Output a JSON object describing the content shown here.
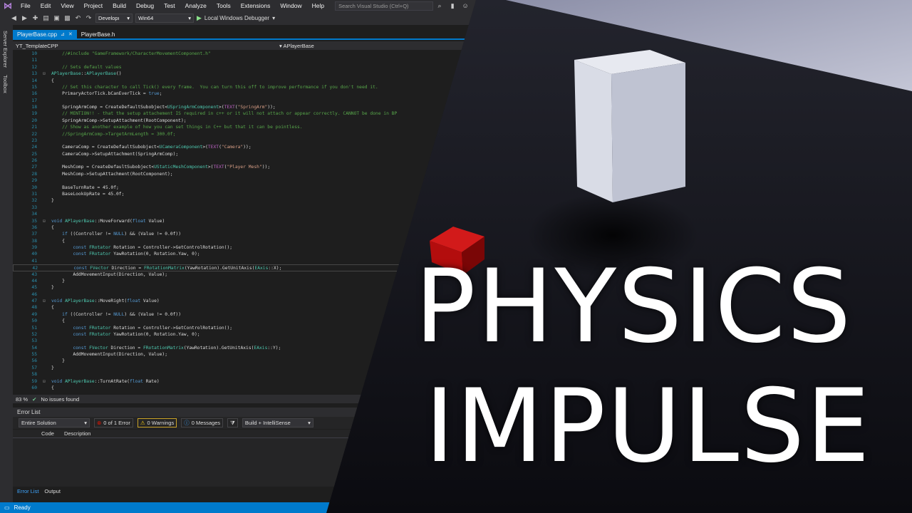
{
  "menu": {
    "items": [
      "File",
      "Edit",
      "View",
      "Project",
      "Build",
      "Debug",
      "Test",
      "Analyze",
      "Tools",
      "Extensions",
      "Window",
      "Help"
    ],
    "search_placeholder": "Search Visual Studio (Ctrl+Q)"
  },
  "toolbar": {
    "config": "Developı",
    "platform": "Win64",
    "debugger": "Local Windows Debugger"
  },
  "side_tabs": {
    "server_explorer": "Server Explorer",
    "toolbox": "Toolbox"
  },
  "tabs": [
    {
      "label": "PlayerBase.cpp",
      "active": true
    },
    {
      "label": "PlayerBase.h",
      "active": false
    }
  ],
  "navbar": {
    "project": "YT_TemplateCPP",
    "scope": "APlayerBase"
  },
  "code": [
    {
      "n": "10",
      "t": "    //#include \"GameFramework/CharacterMovementComponent.h\"",
      "k": "cm"
    },
    {
      "n": "11",
      "t": "",
      "k": ""
    },
    {
      "n": "12",
      "t": "    // Sets default values",
      "k": "cm"
    },
    {
      "n": "13",
      "t": "APlayerBase::APlayerBase()",
      "k": "fn"
    },
    {
      "n": "14",
      "t": "{",
      "k": ""
    },
    {
      "n": "15",
      "t": "    // Set this character to call Tick() every frame.  You can turn this off to improve performance if you don't need it.",
      "k": "cm"
    },
    {
      "n": "16",
      "t": "    PrimaryActorTick.bCanEverTick = true;",
      "k": ""
    },
    {
      "n": "17",
      "t": "",
      "k": ""
    },
    {
      "n": "18",
      "t": "    SpringArmComp = CreateDefaultSubobject<USpringArmComponent>(TEXT(\"SpringArm\"));",
      "k": ""
    },
    {
      "n": "19",
      "t": "    // MENTION!! - that the setup attachement IS required in c++ or it will not attach or appear correctly. CANNOT be done in BP",
      "k": "cm"
    },
    {
      "n": "20",
      "t": "    SpringArmComp->SetupAttachment(RootComponent);",
      "k": ""
    },
    {
      "n": "21",
      "t": "    // Show as another example of how you can set things in C++ but that it can be pointless.",
      "k": "cm"
    },
    {
      "n": "22",
      "t": "    //SpringArmComp->TargetArmLength = 300.0f;",
      "k": "cm"
    },
    {
      "n": "23",
      "t": "",
      "k": ""
    },
    {
      "n": "24",
      "t": "    CameraComp = CreateDefaultSubobject<UCameraComponent>(TEXT(\"Camera\"));",
      "k": ""
    },
    {
      "n": "25",
      "t": "    CameraComp->SetupAttachment(SpringArmComp);",
      "k": ""
    },
    {
      "n": "26",
      "t": "",
      "k": ""
    },
    {
      "n": "27",
      "t": "    MeshComp = CreateDefaultSubobject<UStaticMeshComponent>(TEXT(\"Player Mesh\"));",
      "k": ""
    },
    {
      "n": "28",
      "t": "    MeshComp->SetupAttachment(RootComponent);",
      "k": ""
    },
    {
      "n": "29",
      "t": "",
      "k": ""
    },
    {
      "n": "30",
      "t": "    BaseTurnRate = 45.0f;",
      "k": ""
    },
    {
      "n": "31",
      "t": "    BaseLookUpRate = 45.0f;",
      "k": ""
    },
    {
      "n": "32",
      "t": "}",
      "k": ""
    },
    {
      "n": "33",
      "t": "",
      "k": ""
    },
    {
      "n": "34",
      "t": "",
      "k": ""
    },
    {
      "n": "35",
      "t": "void APlayerBase::MoveForward(float Value)",
      "k": "fn"
    },
    {
      "n": "36",
      "t": "{",
      "k": ""
    },
    {
      "n": "37",
      "t": "    if ((Controller != NULL) && (Value != 0.0f))",
      "k": ""
    },
    {
      "n": "38",
      "t": "    {",
      "k": ""
    },
    {
      "n": "39",
      "t": "        const FRotator Rotation = Controller->GetControlRotation();",
      "k": ""
    },
    {
      "n": "40",
      "t": "        const FRotator YawRotation(0, Rotation.Yaw, 0);",
      "k": ""
    },
    {
      "n": "41",
      "t": "",
      "k": ""
    },
    {
      "n": "42",
      "t": "        const FVector Direction = FRotationMatrix(YawRotation).GetUnitAxis(EAxis::X);",
      "k": "cur"
    },
    {
      "n": "43",
      "t": "        AddMovementInput(Direction, Value);",
      "k": ""
    },
    {
      "n": "44",
      "t": "    }",
      "k": ""
    },
    {
      "n": "45",
      "t": "}",
      "k": ""
    },
    {
      "n": "46",
      "t": "",
      "k": ""
    },
    {
      "n": "47",
      "t": "void APlayerBase::MoveRight(float Value)",
      "k": "fn"
    },
    {
      "n": "48",
      "t": "{",
      "k": ""
    },
    {
      "n": "49",
      "t": "    if ((Controller != NULL) && (Value != 0.0f))",
      "k": ""
    },
    {
      "n": "50",
      "t": "    {",
      "k": ""
    },
    {
      "n": "51",
      "t": "        const FRotator Rotation = Controller->GetControlRotation();",
      "k": ""
    },
    {
      "n": "52",
      "t": "        const FRotator YawRotation(0, Rotation.Yaw, 0);",
      "k": ""
    },
    {
      "n": "53",
      "t": "",
      "k": ""
    },
    {
      "n": "54",
      "t": "        const FVector Direction = FRotationMatrix(YawRotation).GetUnitAxis(EAxis::Y);",
      "k": ""
    },
    {
      "n": "55",
      "t": "        AddMovementInput(Direction, Value);",
      "k": ""
    },
    {
      "n": "56",
      "t": "    }",
      "k": ""
    },
    {
      "n": "57",
      "t": "}",
      "k": ""
    },
    {
      "n": "58",
      "t": "",
      "k": ""
    },
    {
      "n": "59",
      "t": "void APlayerBase::TurnAtRate(float Rate)",
      "k": "fn"
    },
    {
      "n": "60",
      "t": "{",
      "k": ""
    }
  ],
  "editor_status": {
    "zoom": "83 %",
    "issues": "No issues found"
  },
  "error_list": {
    "title": "Error List",
    "scope": "Entire Solution",
    "errors": "0 of 1 Error",
    "warnings": "0 Warnings",
    "messages": "0 Messages",
    "source": "Build + IntelliSense",
    "columns": [
      "Code",
      "Description"
    ]
  },
  "bottom_tabs": [
    "Error List",
    "Output"
  ],
  "status": {
    "text": "Ready"
  },
  "title": {
    "line1": "PHYSICS",
    "line2": "IMPULSE"
  },
  "colors": {
    "accent": "#007acc",
    "cube_red": "#c81010",
    "cube_white": "#d7dbe6"
  }
}
